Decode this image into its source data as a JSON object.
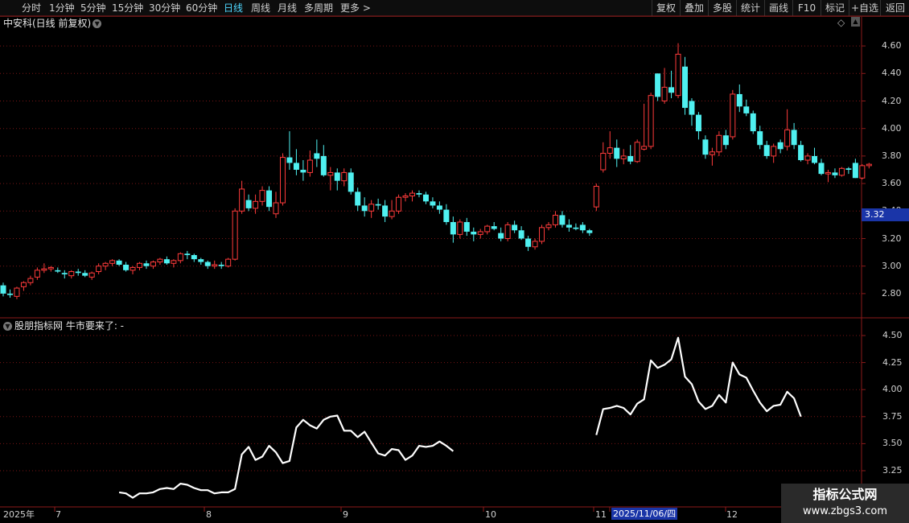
{
  "toolbar": {
    "left_items": [
      "分时",
      "1分钟",
      "5分钟",
      "15分钟",
      "30分钟",
      "60分钟",
      "日线",
      "周线",
      "月线",
      "多周期",
      "更多 >"
    ],
    "active_item": "日线",
    "right_items": [
      "复权",
      "叠加",
      "多股",
      "统计",
      "画线",
      "F10",
      "标记",
      "+自选",
      "返回"
    ]
  },
  "main_chart": {
    "title": "中安科(日线 前复权)",
    "current_price_tag": "3.32",
    "y_ticks": [
      "4.60",
      "4.40",
      "4.20",
      "4.00",
      "3.80",
      "3.60",
      "3.40",
      "3.20",
      "3.00",
      "2.80"
    ]
  },
  "indicator": {
    "title": "股朋指标网 牛市要来了: -",
    "y_ticks": [
      "4.50",
      "4.25",
      "4.00",
      "3.75",
      "3.50",
      "3.25"
    ]
  },
  "x_axis": {
    "labels": [
      "2025年",
      "7",
      "8",
      "9",
      "10",
      "11",
      "12"
    ],
    "selected_date": "2025/11/06/四"
  },
  "watermark": {
    "line1": "指标公式网",
    "line2": "www.zbgs3.com"
  },
  "colors": {
    "up": "#ff3b3b",
    "down": "#4ff0f0",
    "line": "#ffffff",
    "grid": "#7a1515",
    "axis": "#8b1a1a",
    "active_tab": "#4fd8ff",
    "price_tag_bg": "#1a35a8"
  },
  "chart_data": [
    {
      "type": "candlestick",
      "title": "中安科(日线 前复权)",
      "ylim": [
        2.7,
        4.7
      ],
      "candles": [
        [
          2.86,
          2.88,
          2.78,
          2.8
        ],
        [
          2.8,
          2.83,
          2.77,
          2.79
        ],
        [
          2.78,
          2.85,
          2.76,
          2.84
        ],
        [
          2.85,
          2.89,
          2.82,
          2.88
        ],
        [
          2.88,
          2.93,
          2.86,
          2.91
        ],
        [
          2.92,
          2.99,
          2.9,
          2.97
        ],
        [
          2.97,
          3.02,
          2.95,
          2.98
        ],
        [
          2.98,
          3.0,
          2.96,
          2.99
        ],
        [
          2.97,
          2.99,
          2.95,
          2.96
        ],
        [
          2.95,
          2.97,
          2.91,
          2.94
        ],
        [
          2.93,
          2.97,
          2.91,
          2.96
        ],
        [
          2.96,
          2.98,
          2.93,
          2.95
        ],
        [
          2.95,
          2.97,
          2.92,
          2.93
        ],
        [
          2.92,
          2.96,
          2.9,
          2.95
        ],
        [
          2.96,
          3.02,
          2.94,
          3.0
        ],
        [
          3.0,
          3.03,
          2.97,
          3.02
        ],
        [
          3.02,
          3.05,
          3.0,
          3.04
        ],
        [
          3.04,
          3.05,
          3.0,
          3.01
        ],
        [
          3.01,
          3.03,
          2.96,
          2.97
        ],
        [
          2.97,
          3.0,
          2.94,
          2.99
        ],
        [
          2.99,
          3.03,
          2.97,
          3.02
        ],
        [
          3.02,
          3.04,
          2.98,
          3.0
        ],
        [
          3.0,
          3.04,
          2.98,
          3.03
        ],
        [
          3.03,
          3.06,
          3.01,
          3.05
        ],
        [
          3.05,
          3.07,
          3.01,
          3.02
        ],
        [
          3.02,
          3.05,
          2.99,
          3.04
        ],
        [
          3.04,
          3.1,
          3.02,
          3.09
        ],
        [
          3.09,
          3.11,
          3.05,
          3.08
        ],
        [
          3.08,
          3.09,
          3.03,
          3.05
        ],
        [
          3.05,
          3.06,
          3.01,
          3.03
        ],
        [
          3.03,
          3.04,
          2.98,
          3.0
        ],
        [
          3.0,
          3.04,
          2.98,
          3.01
        ],
        [
          3.01,
          3.03,
          2.98,
          3.0
        ],
        [
          3.0,
          3.06,
          2.99,
          3.05
        ],
        [
          3.05,
          3.42,
          3.04,
          3.4
        ],
        [
          3.4,
          3.62,
          3.38,
          3.56
        ],
        [
          3.48,
          3.52,
          3.4,
          3.42
        ],
        [
          3.42,
          3.52,
          3.38,
          3.47
        ],
        [
          3.47,
          3.58,
          3.44,
          3.55
        ],
        [
          3.55,
          3.58,
          3.4,
          3.43
        ],
        [
          3.38,
          3.54,
          3.35,
          3.46
        ],
        [
          3.46,
          3.82,
          3.44,
          3.79
        ],
        [
          3.79,
          3.98,
          3.7,
          3.75
        ],
        [
          3.75,
          3.85,
          3.66,
          3.7
        ],
        [
          3.7,
          3.77,
          3.62,
          3.68
        ],
        [
          3.68,
          3.84,
          3.65,
          3.77
        ],
        [
          3.82,
          3.92,
          3.72,
          3.78
        ],
        [
          3.8,
          3.88,
          3.65,
          3.66
        ],
        [
          3.66,
          3.72,
          3.55,
          3.68
        ],
        [
          3.68,
          3.71,
          3.55,
          3.62
        ],
        [
          3.62,
          3.71,
          3.58,
          3.68
        ],
        [
          3.68,
          3.71,
          3.52,
          3.54
        ],
        [
          3.54,
          3.57,
          3.4,
          3.44
        ],
        [
          3.44,
          3.5,
          3.36,
          3.4
        ],
        [
          3.4,
          3.48,
          3.35,
          3.45
        ],
        [
          3.45,
          3.49,
          3.41,
          3.44
        ],
        [
          3.44,
          3.48,
          3.32,
          3.36
        ],
        [
          3.36,
          3.48,
          3.34,
          3.4
        ],
        [
          3.4,
          3.52,
          3.38,
          3.5
        ],
        [
          3.5,
          3.53,
          3.47,
          3.51
        ],
        [
          3.51,
          3.55,
          3.47,
          3.53
        ],
        [
          3.53,
          3.55,
          3.5,
          3.52
        ],
        [
          3.52,
          3.54,
          3.45,
          3.47
        ],
        [
          3.47,
          3.5,
          3.42,
          3.44
        ],
        [
          3.44,
          3.47,
          3.38,
          3.41
        ],
        [
          3.41,
          3.45,
          3.3,
          3.32
        ],
        [
          3.32,
          3.36,
          3.17,
          3.23
        ],
        [
          3.23,
          3.34,
          3.2,
          3.32
        ],
        [
          3.32,
          3.35,
          3.22,
          3.25
        ],
        [
          3.25,
          3.28,
          3.18,
          3.23
        ],
        [
          3.23,
          3.27,
          3.2,
          3.25
        ],
        [
          3.25,
          3.3,
          3.23,
          3.29
        ],
        [
          3.29,
          3.32,
          3.26,
          3.27
        ],
        [
          3.24,
          3.28,
          3.18,
          3.2
        ],
        [
          3.2,
          3.32,
          3.18,
          3.3
        ],
        [
          3.3,
          3.33,
          3.24,
          3.26
        ],
        [
          3.26,
          3.29,
          3.19,
          3.2
        ],
        [
          3.2,
          3.22,
          3.11,
          3.14
        ],
        [
          3.14,
          3.2,
          3.12,
          3.18
        ],
        [
          3.18,
          3.3,
          3.16,
          3.28
        ],
        [
          3.28,
          3.32,
          3.26,
          3.3
        ],
        [
          3.3,
          3.4,
          3.28,
          3.37
        ],
        [
          3.37,
          3.4,
          3.28,
          3.3
        ],
        [
          3.3,
          3.34,
          3.25,
          3.28
        ],
        [
          3.28,
          3.31,
          3.26,
          3.27
        ],
        [
          3.3,
          3.32,
          3.24,
          3.26
        ],
        [
          3.26,
          3.27,
          3.22,
          3.24
        ],
        [
          3.43,
          3.6,
          3.4,
          3.58
        ],
        [
          3.7,
          3.9,
          3.68,
          3.82
        ],
        [
          3.82,
          3.98,
          3.78,
          3.86
        ],
        [
          3.86,
          3.92,
          3.72,
          3.78
        ],
        [
          3.78,
          3.85,
          3.74,
          3.8
        ],
        [
          3.8,
          3.88,
          3.74,
          3.76
        ],
        [
          3.76,
          3.92,
          3.75,
          3.9
        ],
        [
          3.85,
          4.18,
          3.84,
          3.87
        ],
        [
          3.87,
          4.26,
          3.85,
          4.24
        ],
        [
          4.4,
          4.4,
          4.2,
          4.23
        ],
        [
          4.2,
          4.44,
          4.18,
          4.3
        ],
        [
          4.3,
          4.42,
          4.22,
          4.26
        ],
        [
          4.24,
          4.62,
          4.22,
          4.54
        ],
        [
          4.45,
          4.52,
          4.1,
          4.15
        ],
        [
          4.2,
          4.22,
          4.02,
          4.1
        ],
        [
          4.1,
          4.12,
          3.92,
          3.98
        ],
        [
          3.92,
          3.95,
          3.78,
          3.81
        ],
        [
          3.81,
          3.86,
          3.73,
          3.83
        ],
        [
          3.83,
          3.98,
          3.8,
          3.95
        ],
        [
          3.95,
          3.99,
          3.85,
          3.88
        ],
        [
          3.94,
          4.28,
          3.92,
          4.25
        ],
        [
          4.25,
          4.32,
          4.12,
          4.16
        ],
        [
          4.16,
          4.21,
          4.09,
          4.11
        ],
        [
          4.11,
          4.13,
          3.96,
          3.98
        ],
        [
          3.98,
          4.02,
          3.85,
          3.88
        ],
        [
          3.88,
          3.91,
          3.78,
          3.8
        ],
        [
          3.8,
          3.89,
          3.75,
          3.87
        ],
        [
          3.9,
          3.92,
          3.82,
          3.85
        ],
        [
          3.87,
          4.14,
          3.84,
          3.99
        ],
        [
          3.99,
          4.04,
          3.85,
          3.88
        ],
        [
          3.88,
          3.91,
          3.76,
          3.77
        ],
        [
          3.77,
          3.82,
          3.74,
          3.8
        ],
        [
          3.8,
          3.86,
          3.74,
          3.75
        ],
        [
          3.75,
          3.78,
          3.66,
          3.67
        ],
        [
          3.67,
          3.7,
          3.61,
          3.68
        ],
        [
          3.68,
          3.71,
          3.64,
          3.66
        ],
        [
          3.66,
          3.72,
          3.65,
          3.71
        ],
        [
          3.71,
          3.72,
          3.67,
          3.7
        ],
        [
          3.75,
          3.78,
          3.64,
          3.64
        ],
        [
          3.64,
          3.74,
          3.63,
          3.73
        ],
        [
          3.73,
          3.75,
          3.71,
          3.74
        ]
      ]
    },
    {
      "type": "line",
      "title": "牛市要来了",
      "ylim": [
        3.05,
        4.62
      ],
      "segments": [
        {
          "start_index": 17,
          "values": [
            3.05,
            3.04,
            3.0,
            3.04,
            3.04,
            3.05,
            3.08,
            3.09,
            3.08,
            3.13,
            3.12,
            3.09,
            3.07,
            3.07,
            3.04,
            3.05,
            3.05,
            3.08,
            3.4,
            3.47,
            3.35,
            3.38,
            3.48,
            3.42,
            3.32,
            3.34,
            3.65,
            3.72,
            3.67,
            3.64,
            3.72,
            3.75,
            3.76,
            3.62,
            3.62,
            3.56,
            3.61,
            3.51,
            3.41,
            3.39,
            3.45,
            3.44,
            3.35,
            3.39,
            3.48,
            3.47,
            3.48,
            3.52,
            3.48,
            3.43
          ]
        },
        {
          "start_index": 87,
          "values": [
            3.58,
            3.82,
            3.83,
            3.85,
            3.83,
            3.77,
            3.87,
            3.91,
            4.27,
            4.2,
            4.23,
            4.28,
            4.48,
            4.12,
            4.05,
            3.89,
            3.82,
            3.85,
            3.95,
            3.88,
            4.25,
            4.14,
            4.11,
            3.99,
            3.88,
            3.8,
            3.85,
            3.86,
            3.98,
            3.92,
            3.75
          ]
        }
      ]
    }
  ]
}
